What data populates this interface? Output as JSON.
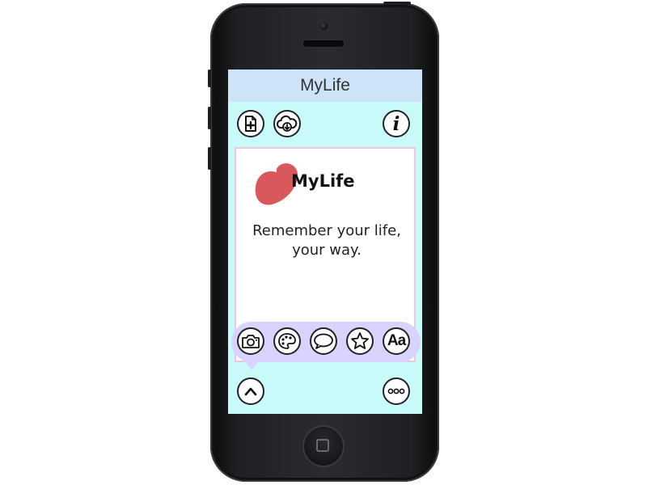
{
  "app": {
    "title": "MyLife"
  },
  "top_toolbar": {
    "new_page_icon": "add-page-icon",
    "download_icon": "cloud-download-icon",
    "info_icon": "info-icon",
    "info_glyph": "i"
  },
  "card": {
    "logo_text": "MyLife",
    "logo_icon": "heart-icon",
    "tagline": "Remember your life, your way."
  },
  "tool_palette": {
    "items": [
      {
        "icon": "camera-icon"
      },
      {
        "icon": "palette-icon"
      },
      {
        "icon": "speech-bubble-icon"
      },
      {
        "icon": "star-icon"
      },
      {
        "icon": "text-icon",
        "label": "Aa"
      }
    ]
  },
  "bottom_bar": {
    "toggle_icon": "chevron-up-icon",
    "more_icon": "more-icon"
  },
  "colors": {
    "screen_background": "#c8fafa",
    "title_bar": "#cde3f7",
    "palette_bubble": "#d8d4ff",
    "card_border": "#f0c6dc",
    "heart": "#d9585c"
  }
}
